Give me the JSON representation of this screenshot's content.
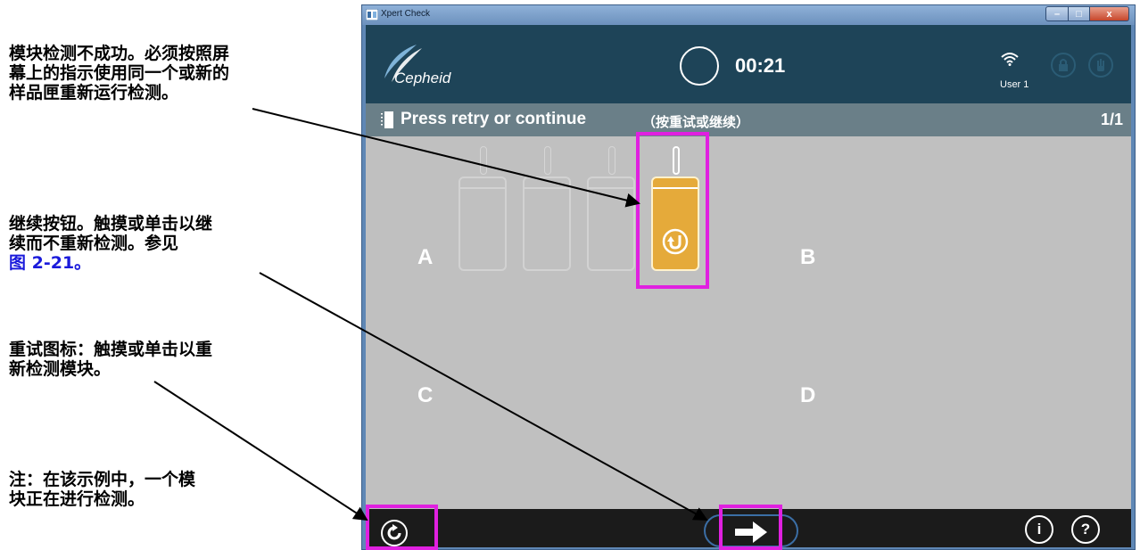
{
  "annotations": {
    "note1": [
      "模块检测不成功。必须按照屏",
      "幕上的指示使用同一个或新的",
      "样品匣重新运行检测。"
    ],
    "note2": [
      "继续按钮。触摸或单击以继",
      "续而不重新检测。参见"
    ],
    "note2_link": "图 2-21。",
    "note3": [
      "重试图标：触摸或单击以重",
      "新检测模块。"
    ],
    "note4": [
      "注：在该示例中，一个模",
      "块正在进行检测。"
    ]
  },
  "window": {
    "title": "Xpert Check",
    "controls": {
      "minimize": "–",
      "maximize": "□",
      "close": "x"
    }
  },
  "header": {
    "logo_text": "Cepheid",
    "timer": "00:21",
    "user": "User 1",
    "icons": [
      "wifi-icon",
      "lock-icon",
      "hand-icon"
    ]
  },
  "status_bar": {
    "message": "Press retry or continue",
    "message_cn": "（按重试或继续）",
    "page": "1/1"
  },
  "modules": {
    "letters": {
      "a": "A",
      "b": "B",
      "c": "C",
      "d": "D"
    },
    "bays": [
      {
        "state": "empty"
      },
      {
        "state": "empty"
      },
      {
        "state": "empty"
      },
      {
        "state": "retry",
        "color": "#e5aa3a"
      }
    ]
  },
  "bottom_bar": {
    "icons": [
      "retry-icon",
      "continue-arrow-icon"
    ],
    "info": "i",
    "help": "?"
  },
  "colors": {
    "header": "#1e4458",
    "status_bar": "#6a7f88",
    "module_area": "#c0c0c0",
    "bottom_bar": "#1b1b1b",
    "highlight": "#e020e0",
    "retry_module": "#e5aa3a"
  }
}
